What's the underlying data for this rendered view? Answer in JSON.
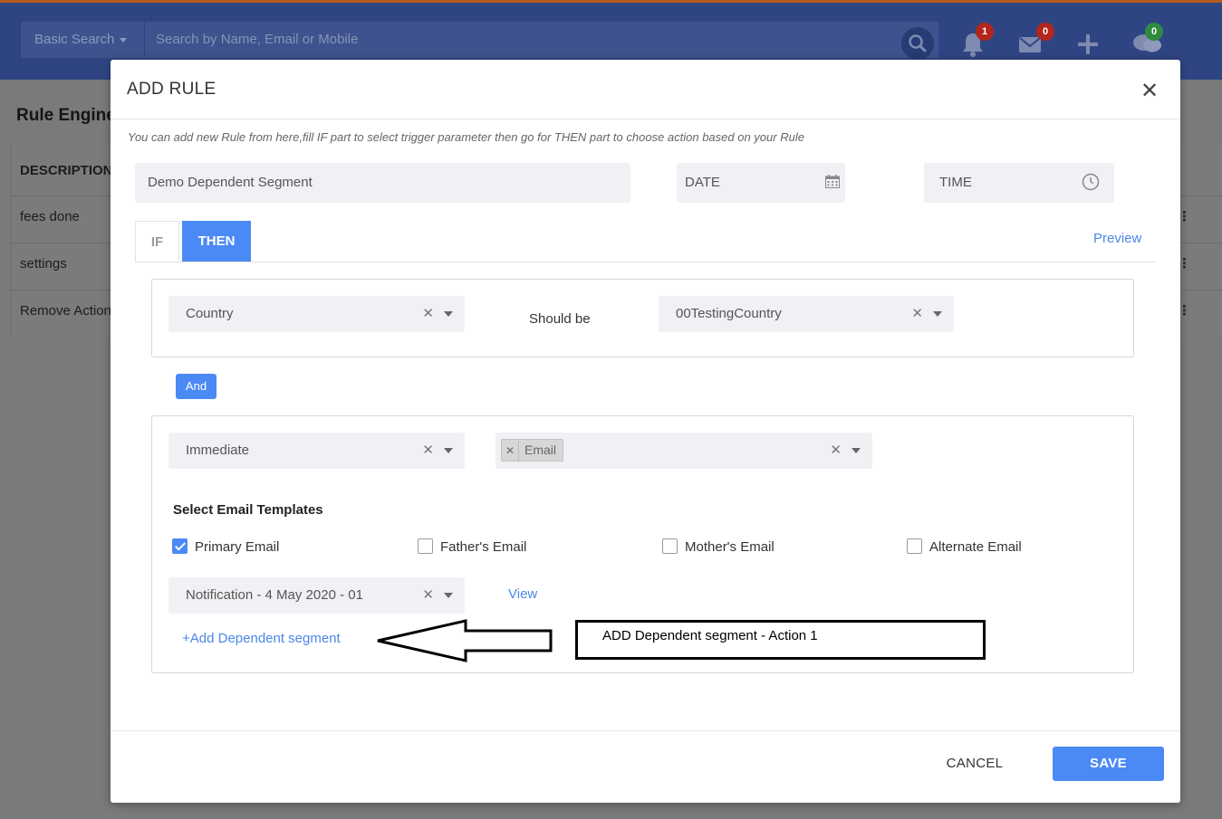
{
  "background": {
    "search": {
      "type_label": "Basic Search",
      "placeholder": "Search by Name, Email or Mobile"
    },
    "badges": {
      "notifications": "1",
      "messages": "0",
      "chat": "0"
    },
    "page_title": "Rule Engine",
    "table": {
      "header": "DESCRIPTION",
      "rows": [
        "fees done",
        "settings",
        "Remove Action"
      ]
    }
  },
  "modal": {
    "title": "ADD RULE",
    "hint": "You can add new Rule from here,fill IF part to select trigger parameter then go for THEN part to choose action based on your Rule",
    "rule_name": "Demo Dependent Segment",
    "date_placeholder": "DATE",
    "time_placeholder": "TIME",
    "tabs": {
      "if": "IF",
      "then": "THEN",
      "active": "THEN"
    },
    "preview": "Preview",
    "condition": {
      "field": "Country",
      "operator": "Should be",
      "value": "00TestingCountry"
    },
    "and_label": "And",
    "action": {
      "timing": "Immediate",
      "channel_chip": "Email",
      "templates_title": "Select Email Templates",
      "checkboxes": [
        {
          "label": "Primary Email",
          "checked": true
        },
        {
          "label": "Father's Email",
          "checked": false
        },
        {
          "label": "Mother's Email",
          "checked": false
        },
        {
          "label": "Alternate Email",
          "checked": false
        }
      ],
      "template": "Notification - 4 May 2020 - 01",
      "view": "View",
      "add_dependent": "+Add Dependent segment"
    },
    "cancel": "CANCEL",
    "save": "SAVE"
  },
  "annotation": {
    "text": "ADD Dependent segment - Action 1"
  },
  "colors": {
    "primary": "#4b8af5",
    "link": "#4b87e8",
    "appbar": "#2f4583",
    "badge_red": "#c62828",
    "badge_green": "#2e9e3e"
  }
}
